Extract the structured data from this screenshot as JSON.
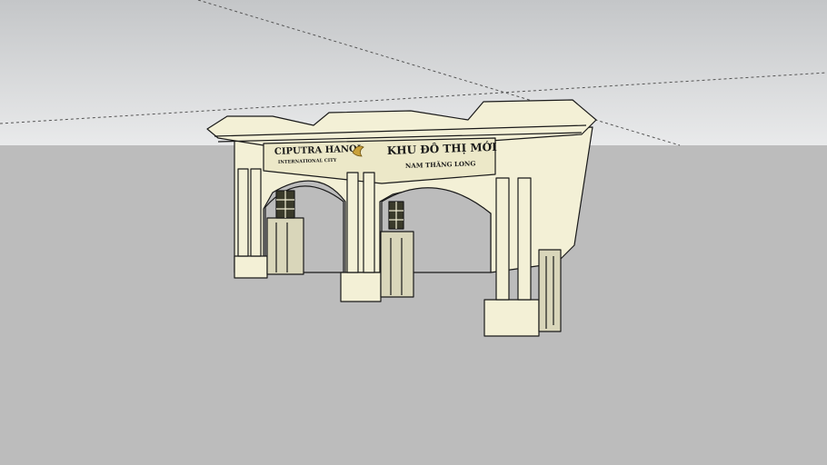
{
  "scene": {
    "colors": {
      "sky_top": "#c4c6c8",
      "sky_bottom": "#e9eaeb",
      "ground": "#bcbcbc",
      "stone": "#f3f0d6",
      "shadow": "#d9d6ba",
      "edge": "#1a1a1a"
    },
    "sign": {
      "brand_name": "CIPUTRA HANOI",
      "brand_sub": "INTERNATIONAL CITY",
      "title": "KHU ĐÔ THỊ MỚI",
      "subtitle": "NAM THĂNG LONG"
    },
    "icons": {
      "logo": "ciputra-logo-icon"
    }
  }
}
